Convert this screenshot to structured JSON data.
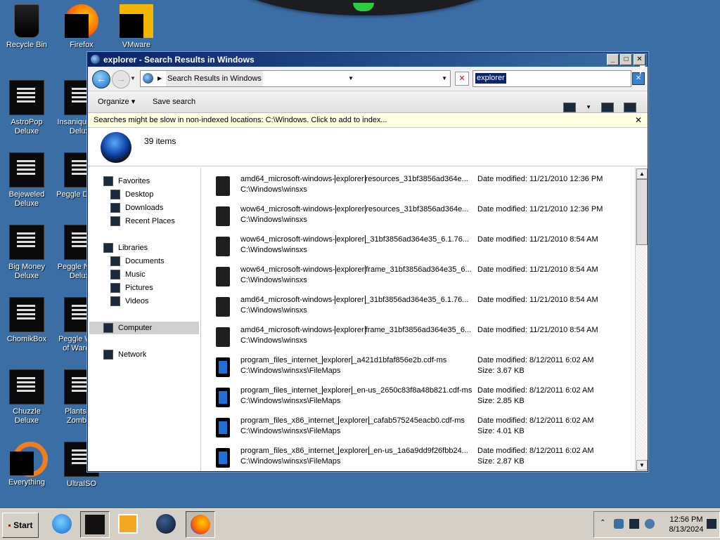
{
  "desktop": {
    "icons": [
      {
        "label": "Recycle Bin"
      },
      {
        "label": "Firefox"
      },
      {
        "label": "VMware"
      },
      {
        "label": "AstroPop Deluxe"
      },
      {
        "label": "Insaniquarium Deluxe"
      },
      {
        "label": "Bejeweled Deluxe"
      },
      {
        "label": "Peggle Deluxe"
      },
      {
        "label": "Big Money Deluxe"
      },
      {
        "label": "Peggle Nights Deluxe"
      },
      {
        "label": "ChomikBox"
      },
      {
        "label": "Peggle World of Warcraft"
      },
      {
        "label": "Chuzzle Deluxe"
      },
      {
        "label": "Plants vs. Zombies"
      },
      {
        "label": "Everything"
      },
      {
        "label": "UltraISO"
      }
    ]
  },
  "window": {
    "title": "explorer - Search Results in Windows",
    "address": {
      "breadcrumb": "Search Results in Windows"
    },
    "search": {
      "value": "explorer"
    },
    "toolbar": {
      "organize": "Organize",
      "save_search": "Save search"
    },
    "infobar": {
      "text": "Searches might be slow in non-indexed locations: C:\\Windows. Click to add to index..."
    },
    "details": {
      "count": "39 items"
    },
    "nav": {
      "favorites": "Favorites",
      "desktop": "Desktop",
      "downloads": "Downloads",
      "recent": "Recent Places",
      "libraries": "Libraries",
      "documents": "Documents",
      "music": "Music",
      "pictures": "Pictures",
      "videos": "Videos",
      "computer": "Computer",
      "network": "Network"
    },
    "results": [
      {
        "pre": "amd64_microsoft-windows-",
        "hl": "explorer",
        "post": "resources_31bf3856ad364e...",
        "path": "C:\\Windows\\winsxs",
        "date": "Date modified: 11/21/2010 12:36 PM",
        "size": ""
      },
      {
        "pre": "wow64_microsoft-windows-",
        "hl": "explorer",
        "post": "resources_31bf3856ad364e...",
        "path": "C:\\Windows\\winsxs",
        "date": "Date modified: 11/21/2010 12:36 PM",
        "size": ""
      },
      {
        "pre": "wow64_microsoft-windows-",
        "hl": "explorer",
        "post": "_31bf3856ad364e35_6.1.76...",
        "path": "C:\\Windows\\winsxs",
        "date": "Date modified: 11/21/2010 8:54 AM",
        "size": ""
      },
      {
        "pre": "wow64_microsoft-windows-",
        "hl": "explorer",
        "post": "frame_31bf3856ad364e35_6...",
        "path": "C:\\Windows\\winsxs",
        "date": "Date modified: 11/21/2010 8:54 AM",
        "size": ""
      },
      {
        "pre": "amd64_microsoft-windows-",
        "hl": "explorer",
        "post": "_31bf3856ad364e35_6.1.76...",
        "path": "C:\\Windows\\winsxs",
        "date": "Date modified: 11/21/2010 8:54 AM",
        "size": ""
      },
      {
        "pre": "amd64_microsoft-windows-",
        "hl": "explorer",
        "post": "frame_31bf3856ad364e35_6...",
        "path": "C:\\Windows\\winsxs",
        "date": "Date modified: 11/21/2010 8:54 AM",
        "size": ""
      },
      {
        "pre": "program_files_internet_",
        "hl": "explorer",
        "post": "_a421d1bfaf856e2b.cdf-ms",
        "path": "C:\\Windows\\winsxs\\FileMaps",
        "date": "Date modified: 8/12/2011 6:02 AM",
        "size": "Size: 3.67 KB"
      },
      {
        "pre": "program_files_internet_",
        "hl": "explorer",
        "post": "_en-us_2650c83f8a48b821.cdf-ms",
        "path": "C:\\Windows\\winsxs\\FileMaps",
        "date": "Date modified: 8/12/2011 6:02 AM",
        "size": "Size: 2.85 KB"
      },
      {
        "pre": "program_files_x86_internet_",
        "hl": "explorer",
        "post": "_cafab575245eacb0.cdf-ms",
        "path": "C:\\Windows\\winsxs\\FileMaps",
        "date": "Date modified: 8/12/2011 6:02 AM",
        "size": "Size: 4.01 KB"
      },
      {
        "pre": "program_files_x86_internet_",
        "hl": "explorer",
        "post": "_en-us_1a6a9dd9f26fbb24...",
        "path": "C:\\Windows\\winsxs\\FileMaps",
        "date": "Date modified: 8/12/2011 6:02 AM",
        "size": "Size: 2.87 KB"
      }
    ]
  },
  "taskbar": {
    "start": "Start",
    "clock": {
      "time": "12:56 PM",
      "date": "8/13/2024"
    }
  }
}
